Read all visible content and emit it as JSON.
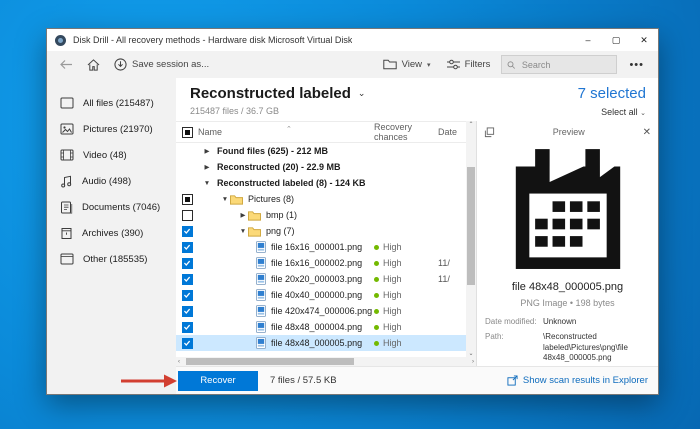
{
  "colors": {
    "accent": "#0078d7",
    "selected_row": "#cce8ff",
    "link": "#0f6cbd",
    "high_status_dot": "#73b900",
    "annotation_arrow": "#d23f31",
    "desktop_blue": "#0b8ad9"
  },
  "window": {
    "title": "Disk Drill - All recovery methods - Hardware disk Microsoft Virtual Disk",
    "controls": {
      "minimize": "–",
      "maximize": "▢",
      "close": "✕"
    }
  },
  "toolbar": {
    "save_session": "Save session as...",
    "view": "View",
    "filters": "Filters",
    "search_placeholder": "Search",
    "more": "•••"
  },
  "sidebar": {
    "items": [
      {
        "icon": "all-files-icon",
        "label": "All files (215487)"
      },
      {
        "icon": "pictures-icon",
        "label": "Pictures (21970)"
      },
      {
        "icon": "video-icon",
        "label": "Video (48)"
      },
      {
        "icon": "audio-icon",
        "label": "Audio (498)"
      },
      {
        "icon": "documents-icon",
        "label": "Documents (7046)"
      },
      {
        "icon": "archives-icon",
        "label": "Archives (390)"
      },
      {
        "icon": "other-icon",
        "label": "Other (185535)"
      }
    ]
  },
  "main": {
    "title": "Reconstructed labeled",
    "subtitle": "215487 files / 36.7 GB",
    "selected_count": "7 selected",
    "select_all": "Select all"
  },
  "list": {
    "columns": {
      "name": "Name",
      "recovery": "Recovery chances",
      "date": "Date"
    },
    "rows": [
      {
        "label": "Found files (625) - 212 MB",
        "type": "group",
        "level": 0,
        "arrow": "collapsed",
        "check": "none",
        "chance": "",
        "date": "",
        "selected": false
      },
      {
        "label": "Reconstructed (20) - 22.9 MB",
        "type": "group",
        "level": 0,
        "arrow": "collapsed",
        "check": "none",
        "chance": "",
        "date": "",
        "selected": false
      },
      {
        "label": "Reconstructed labeled (8) - 124 KB",
        "type": "group",
        "level": 0,
        "arrow": "expanded",
        "check": "none",
        "chance": "",
        "date": "",
        "selected": false
      },
      {
        "label": "Pictures (8)",
        "type": "folder",
        "level": 1,
        "arrow": "expanded",
        "check": "indeterminate",
        "chance": "",
        "date": "",
        "selected": false
      },
      {
        "label": "bmp (1)",
        "type": "folder",
        "level": 2,
        "arrow": "collapsed",
        "check": "unchecked",
        "chance": "",
        "date": "",
        "selected": false
      },
      {
        "label": "png (7)",
        "type": "folder",
        "level": 2,
        "arrow": "expanded",
        "check": "checked",
        "chance": "",
        "date": "",
        "selected": false
      },
      {
        "label": "file 16x16_000001.png",
        "type": "file",
        "level": 3,
        "arrow": "none",
        "check": "checked",
        "chance": "High",
        "date": "",
        "selected": false
      },
      {
        "label": "file 16x16_000002.png",
        "type": "file",
        "level": 3,
        "arrow": "none",
        "check": "checked",
        "chance": "High",
        "date": "11/",
        "selected": false
      },
      {
        "label": "file 20x20_000003.png",
        "type": "file",
        "level": 3,
        "arrow": "none",
        "check": "checked",
        "chance": "High",
        "date": "11/",
        "selected": false
      },
      {
        "label": "file 40x40_000000.png",
        "type": "file",
        "level": 3,
        "arrow": "none",
        "check": "checked",
        "chance": "High",
        "date": "",
        "selected": false
      },
      {
        "label": "file 420x474_000006.png",
        "type": "file",
        "level": 3,
        "arrow": "none",
        "check": "checked",
        "chance": "High",
        "date": "",
        "selected": false
      },
      {
        "label": "file 48x48_000004.png",
        "type": "file",
        "level": 3,
        "arrow": "none",
        "check": "checked",
        "chance": "High",
        "date": "",
        "selected": false
      },
      {
        "label": "file 48x48_000005.png",
        "type": "file",
        "level": 3,
        "arrow": "none",
        "check": "checked",
        "chance": "High",
        "date": "",
        "selected": true
      }
    ]
  },
  "preview": {
    "header": "Preview",
    "image": "calendar-glyph",
    "filename": "file 48x48_000005.png",
    "meta": "PNG Image • 198 bytes",
    "details": [
      {
        "label": "Date modified:",
        "value": "Unknown"
      },
      {
        "label": "Path:",
        "value": "\\Reconstructed labeled\\Pictures\\png\\file 48x48_000005.png"
      }
    ]
  },
  "footer": {
    "recover": "Recover",
    "summary": "7 files / 57.5 KB",
    "link": "Show scan results in Explorer"
  }
}
